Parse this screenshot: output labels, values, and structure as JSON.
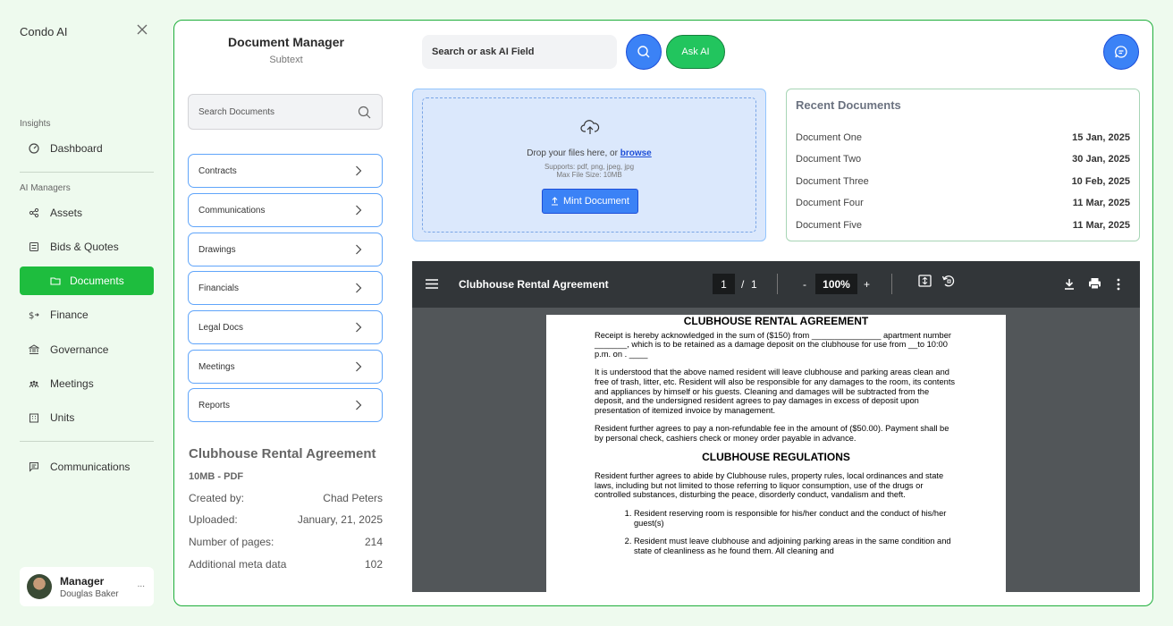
{
  "sidebar": {
    "brand": "Condo AI",
    "insights_label": "Insights",
    "managers_label": "AI Managers",
    "items": [
      {
        "label": "Dashboard",
        "icon": "dashboard-icon"
      },
      {
        "label": "Assets",
        "icon": "share-icon"
      },
      {
        "label": "Bids & Quotes",
        "icon": "list-icon"
      },
      {
        "label": "Documents",
        "icon": "folder-icon"
      },
      {
        "label": "Finance",
        "icon": "finance-icon"
      },
      {
        "label": "Governance",
        "icon": "bank-icon"
      },
      {
        "label": "Meetings",
        "icon": "people-icon"
      },
      {
        "label": "Units",
        "icon": "building-icon"
      },
      {
        "label": "Communications",
        "icon": "message-icon"
      }
    ],
    "user": {
      "role": "Manager",
      "name": "Douglas Baker",
      "more": "..."
    }
  },
  "header": {
    "title": "Document Manager",
    "subtitle": "Subtext",
    "search_label": "Search or ask AI Field",
    "ask_ai": "Ask AI"
  },
  "left_panel": {
    "search_placeholder": "Search Documents",
    "categories": [
      "Contracts",
      "Communications",
      "Drawings",
      "Financials",
      "Legal Docs",
      "Meetings",
      "Reports"
    ],
    "meta": {
      "title": "Clubhouse Rental Agreement",
      "subtitle": "10MB - PDF",
      "rows": [
        {
          "label": "Created by:",
          "value": "Chad Peters"
        },
        {
          "label": "Uploaded:",
          "value": "January, 21, 2025"
        },
        {
          "label": "Number of pages:",
          "value": "214"
        },
        {
          "label": "Additional meta data",
          "value": "102"
        }
      ]
    }
  },
  "upload": {
    "drop_text": "Drop your files here, or",
    "browse": "browse",
    "supports": "Supports: pdf, png, jpeg, jpg",
    "max_size": "Max File Size: 10MB",
    "button": "Mint Document"
  },
  "recent": {
    "title": "Recent Documents",
    "items": [
      {
        "name": "Document One",
        "date": "15 Jan, 2025"
      },
      {
        "name": "Document Two",
        "date": "30 Jan, 2025"
      },
      {
        "name": "Document Three",
        "date": "10 Feb, 2025"
      },
      {
        "name": "Document Four",
        "date": "11 Mar, 2025"
      },
      {
        "name": "Document Five",
        "date": "11 Mar, 2025"
      }
    ]
  },
  "viewer": {
    "title": "Clubhouse Rental Agreement",
    "page_current": "1",
    "page_sep": "/",
    "page_total": "1",
    "zoom_minus": "-",
    "zoom": "100%",
    "zoom_plus": "+",
    "doc": {
      "heading": "CLUBHOUSE RENTAL AGREEMENT",
      "p1": "Receipt is hereby acknowledged in the sum of ($150) from _______________ apartment number _______, which is to be retained as a damage deposit on the clubhouse for use from __to 10:00 p.m. on  .   ____",
      "p2": "It is understood that the above named resident will leave clubhouse and parking areas clean and free of trash, litter, etc.  Resident will also be responsible for any damages to the room, its contents and appliances by himself or his guests.  Cleaning and damages will be subtracted from the deposit, and the undersigned resident agrees to pay damages in excess of deposit upon presentation of itemized invoice by management.",
      "p3": "Resident further agrees to pay a non-refundable fee in the amount of ($50.00).  Payment shall be by personal check, cashiers check or money order payable in advance.",
      "heading2": "CLUBHOUSE REGULATIONS",
      "p4": "Resident further agrees to abide by Clubhouse rules, property rules, local ordinances and state laws, including but not limited to those referring to liquor consumption, use of the drugs or controlled substances, disturbing the peace, disorderly conduct, vandalism and theft.",
      "li1": "Resident reserving room is responsible for his/her conduct and the conduct of his/her guest(s)",
      "li2": "Resident must leave clubhouse and adjoining parking areas in the same condition and state of cleanliness as he found them.  All cleaning and"
    }
  },
  "colors": {
    "accent_green": "#1ebd3e",
    "accent_blue": "#3b82f6",
    "viewer_bg": "#525659",
    "toolbar_bg": "#323639"
  }
}
